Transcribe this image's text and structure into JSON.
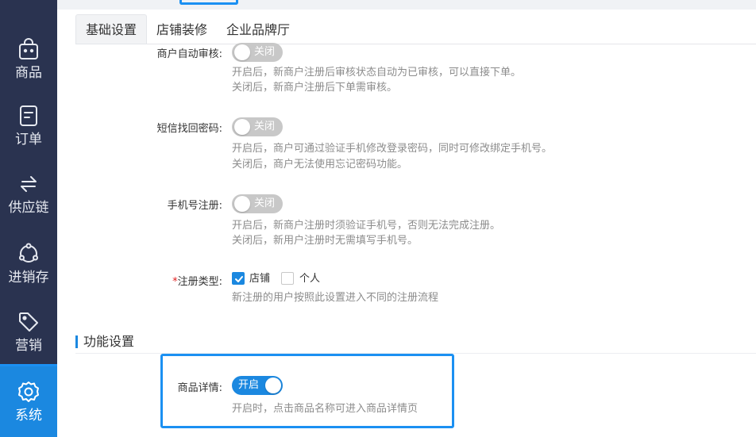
{
  "sidebar": {
    "items": [
      {
        "label": "商品",
        "icon": "shopping-bag-icon"
      },
      {
        "label": "订单",
        "icon": "order-document-icon"
      },
      {
        "label": "供应链",
        "icon": "exchange-arrows-icon"
      },
      {
        "label": "进销存",
        "icon": "inventory-cycle-icon"
      },
      {
        "label": "营销",
        "icon": "tag-icon"
      },
      {
        "label": "系统",
        "icon": "gear-icon",
        "active": true
      }
    ]
  },
  "tabs": [
    {
      "label": "基础设置",
      "active": true
    },
    {
      "label": "店铺装修"
    },
    {
      "label": "企业品牌厅"
    }
  ],
  "settings": {
    "auto_review": {
      "label": "商户自动审核:",
      "toggle": "关闭",
      "help1": "开启后，新商户注册后审核状态自动为已审核，可以直接下单。",
      "help2": "关闭后，新商户注册后下单需审核。"
    },
    "sms_password": {
      "label": "短信找回密码:",
      "toggle": "关闭",
      "help1": "开启后，商户可通过验证手机修改登录密码，同时可修改绑定手机号。",
      "help2": "关闭后，商户无法使用忘记密码功能。"
    },
    "phone_register": {
      "label": "手机号注册:",
      "toggle": "关闭",
      "help1": "开启后，新商户注册时须验证手机号，否则无法完成注册。",
      "help2": "关闭后，新用户注册时无需填写手机号。"
    },
    "register_type": {
      "required_mark": "*",
      "label": "注册类型:",
      "options": [
        {
          "label": "店铺",
          "checked": true
        },
        {
          "label": "个人",
          "checked": false
        }
      ],
      "help": "新注册的用户按照此设置进入不同的注册流程"
    }
  },
  "function_section": {
    "title": "功能设置",
    "product_detail": {
      "label": "商品详情:",
      "toggle": "开启",
      "help": "开启时，点击商品名称可进入商品详情页"
    }
  },
  "colors": {
    "sidebar_bg": "#2a3350",
    "accent": "#1b88e0",
    "toggle_off": "#c8c8c8",
    "highlight": "#1b90f2"
  }
}
